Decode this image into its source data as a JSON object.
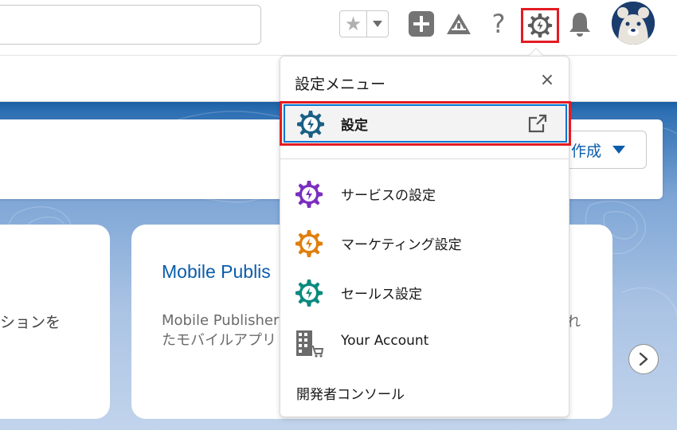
{
  "header": {
    "search_placeholder": "",
    "favorites_star": "★",
    "help_label": "?",
    "icons": [
      "star-icon",
      "chevron-down-icon",
      "plus-icon",
      "trailhead-icon",
      "help-icon",
      "gear-icon",
      "bell-icon",
      "avatar"
    ]
  },
  "main": {
    "create_button": "作成",
    "left_card_desc": "ションを",
    "mid_card": {
      "title": "Mobile Publis",
      "desc_line1": "Mobile Publisher",
      "desc_line2": "たモバイルアプリ",
      "desc_right": "れ"
    }
  },
  "setup_menu": {
    "title": "設定メニュー",
    "close_glyph": "×",
    "items": [
      {
        "label": "設定",
        "icon": "gear-icon",
        "color": "#1b5f85",
        "external": true
      },
      {
        "label": "サービスの設定",
        "icon": "gear-icon",
        "color": "#7b2fbe"
      },
      {
        "label": "マーケティング設定",
        "icon": "gear-icon",
        "color": "#e07f0c"
      },
      {
        "label": "セールス設定",
        "icon": "gear-icon",
        "color": "#0a8a7e"
      },
      {
        "label": "Your Account",
        "icon": "building-cart-icon",
        "color": "#6b6b6b"
      },
      {
        "label": "開発者コンソール"
      }
    ]
  },
  "colors": {
    "highlight_red": "#e31c23",
    "brand_blue": "#0b5cab",
    "band_top": "#1b5fa3"
  }
}
